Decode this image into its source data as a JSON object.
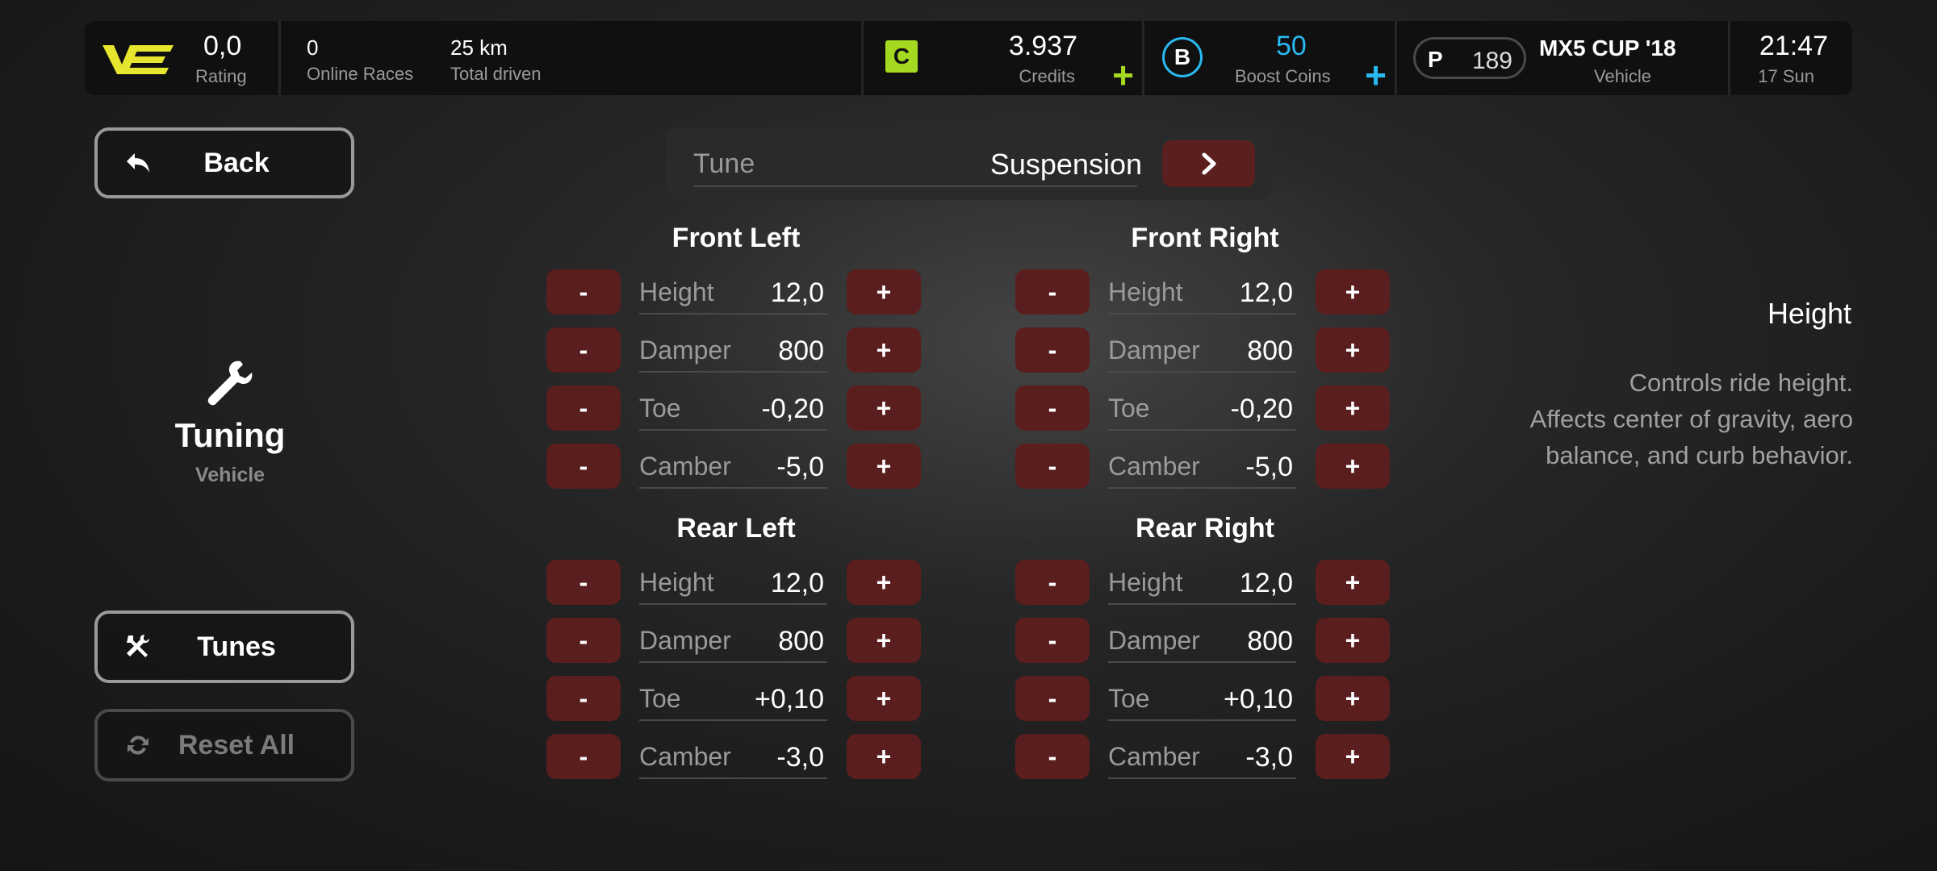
{
  "topbar": {
    "rating": {
      "value": "0,0",
      "label": "Rating"
    },
    "online_races": {
      "value": "0",
      "label": "Online Races"
    },
    "total_driven": {
      "value": "25 km",
      "label": "Total driven"
    },
    "credits": {
      "badge": "C",
      "value": "3.937",
      "label": "Credits",
      "add": "+"
    },
    "boost_coins": {
      "badge": "B",
      "value": "50",
      "label": "Boost Coins",
      "add": "+"
    },
    "pi": {
      "letter": "P",
      "value": "189"
    },
    "vehicle": {
      "value": "MX5 CUP '18",
      "label": "Vehicle"
    },
    "time": {
      "value": "21:47",
      "label": "17 Sun"
    }
  },
  "colors": {
    "accent_green": "#a5d921",
    "accent_blue": "#29b8f0",
    "logo_yellow": "#e6e62e",
    "button_red": "#5a1e1e"
  },
  "left": {
    "back_label": "Back",
    "tuning_title": "Tuning",
    "tuning_subtitle": "Vehicle",
    "tunes_label": "Tunes",
    "reset_label": "Reset All"
  },
  "tune": {
    "label": "Tune",
    "value": "Suspension"
  },
  "controls": {
    "minus": "-",
    "plus": "+"
  },
  "wheels": {
    "front_left": {
      "title": "Front Left",
      "rows": [
        {
          "label": "Height",
          "value": "12,0"
        },
        {
          "label": "Damper",
          "value": "800"
        },
        {
          "label": "Toe",
          "value": "-0,20"
        },
        {
          "label": "Camber",
          "value": "-5,0"
        }
      ]
    },
    "front_right": {
      "title": "Front Right",
      "rows": [
        {
          "label": "Height",
          "value": "12,0"
        },
        {
          "label": "Damper",
          "value": "800"
        },
        {
          "label": "Toe",
          "value": "-0,20"
        },
        {
          "label": "Camber",
          "value": "-5,0"
        }
      ]
    },
    "rear_left": {
      "title": "Rear Left",
      "rows": [
        {
          "label": "Height",
          "value": "12,0"
        },
        {
          "label": "Damper",
          "value": "800"
        },
        {
          "label": "Toe",
          "value": "+0,10"
        },
        {
          "label": "Camber",
          "value": "-3,0"
        }
      ]
    },
    "rear_right": {
      "title": "Rear Right",
      "rows": [
        {
          "label": "Height",
          "value": "12,0"
        },
        {
          "label": "Damper",
          "value": "800"
        },
        {
          "label": "Toe",
          "value": "+0,10"
        },
        {
          "label": "Camber",
          "value": "-3,0"
        }
      ]
    }
  },
  "info": {
    "title": "Height",
    "lines": [
      "Controls ride height.",
      "Affects center of gravity, aero",
      "balance, and curb behavior."
    ]
  }
}
